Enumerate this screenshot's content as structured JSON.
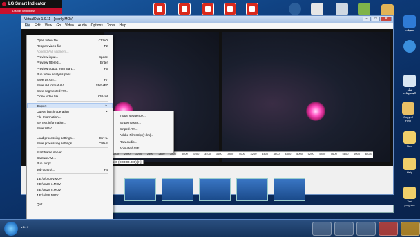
{
  "brand": {
    "name": "LG Smart Indicator",
    "tagline": "Display Brightness",
    "accent": "#c8102e"
  },
  "window": {
    "title": "VirtualDub 1.9.11 - [p only.MOV]",
    "controls": [
      "–",
      "□",
      "✕"
    ]
  },
  "menubar": [
    "File",
    "Edit",
    "View",
    "Go",
    "Video",
    "Audio",
    "Options",
    "Tools",
    "Help"
  ],
  "file_menu": [
    {
      "label": "Open video file...",
      "shortcut": "Ctrl+O"
    },
    {
      "label": "Reopen video file",
      "shortcut": "F2"
    },
    {
      "label": "Append AVI segment...",
      "shortcut": "",
      "disabled": true
    },
    {
      "label": "Preview input...",
      "shortcut": "Space"
    },
    {
      "label": "Preview filtered...",
      "shortcut": "Enter"
    },
    {
      "label": "Preview output from start...",
      "shortcut": "F5"
    },
    {
      "label": "Run video analysis pass",
      "shortcut": ""
    },
    {
      "label": "Save as AVI...",
      "shortcut": "F7"
    },
    {
      "label": "Save old format AVI...",
      "shortcut": "Shift+F7"
    },
    {
      "label": "Save segmented AVI...",
      "shortcut": ""
    },
    {
      "label": "Close video file",
      "shortcut": "Ctrl+W"
    },
    {
      "sep": true
    },
    {
      "label": "Export",
      "shortcut": "▸",
      "highlighted": true
    },
    {
      "label": "Queue batch operation",
      "shortcut": "▸"
    },
    {
      "label": "File Information...",
      "shortcut": ""
    },
    {
      "label": "Set text information...",
      "shortcut": ""
    },
    {
      "label": "Save WAV...",
      "shortcut": ""
    },
    {
      "sep": true
    },
    {
      "label": "Load processing settings...",
      "shortcut": "Ctrl+L"
    },
    {
      "label": "Save processing settings...",
      "shortcut": "Ctrl+S"
    },
    {
      "sep": true
    },
    {
      "label": "Start frame server...",
      "shortcut": ""
    },
    {
      "label": "Capture AVI...",
      "shortcut": ""
    },
    {
      "label": "Run script...",
      "shortcut": ""
    },
    {
      "label": "Job control...",
      "shortcut": "F4"
    },
    {
      "sep": true
    },
    {
      "label": "1 E:\\p\\p only.MOV",
      "shortcut": ""
    },
    {
      "label": "2 E:\\m\\38 n.MOV",
      "shortcut": ""
    },
    {
      "label": "3 E:\\m\\28 n.MOV",
      "shortcut": ""
    },
    {
      "label": "4 E:\\n\\38t.MOV",
      "shortcut": ""
    },
    {
      "sep": true
    },
    {
      "label": "Quit",
      "shortcut": ""
    }
  ],
  "export_submenu": [
    {
      "label": "Image sequence..."
    },
    {
      "label": "Stripe master..."
    },
    {
      "label": "Striped AVI..."
    },
    {
      "label": "Adobe Filmstrip (*.flm)..."
    },
    {
      "label": "Raw audio..."
    },
    {
      "label": "Animated GIF..."
    }
  ],
  "timeline": {
    "ticks": [
      "400",
      "1600",
      "1800",
      "2000",
      "2200",
      "2400",
      "2600",
      "2800",
      "3000",
      "3200",
      "3400",
      "3600",
      "3800",
      "4000",
      "4200",
      "4400",
      "4600",
      "4800",
      "5000",
      "5200",
      "5400",
      "5600",
      "5800",
      "6000",
      "6224"
    ],
    "frame_label": "Frame 0 (0:00:00.000) [K]"
  },
  "taskbar": {
    "clock": "٥:٠٣ م"
  },
  "desktop_icons_right": [
    {
      "label": "تحميلات"
    },
    {
      "label": ""
    },
    {
      "label": "سلة المحذوفات"
    },
    {
      "label": "Copy of Help"
    },
    {
      "label": "New"
    },
    {
      "label": "Help"
    },
    {
      "label": "Text program"
    }
  ]
}
